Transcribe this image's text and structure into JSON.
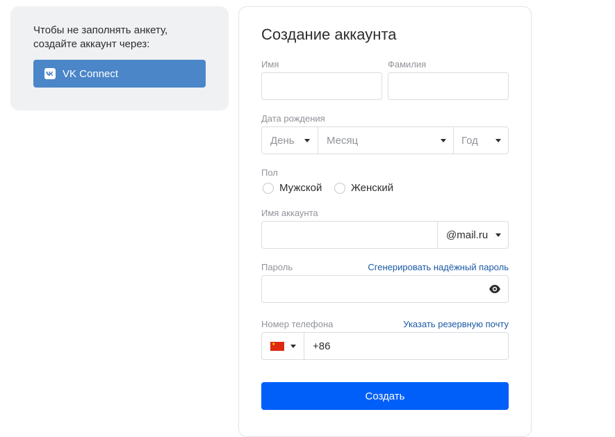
{
  "vk_panel": {
    "text": "Чтобы не заполнять анкету, создайте аккаунт через:",
    "button_label": "VK Connect",
    "button_color": "#4a86c8"
  },
  "form": {
    "title": "Создание аккаунта",
    "first_name": {
      "label": "Имя",
      "value": ""
    },
    "last_name": {
      "label": "Фамилия",
      "value": ""
    },
    "birth_date": {
      "label": "Дата рождения",
      "day_placeholder": "День",
      "month_placeholder": "Месяц",
      "year_placeholder": "Год"
    },
    "gender": {
      "label": "Пол",
      "options": [
        "Мужской",
        "Женский"
      ]
    },
    "account_name": {
      "label": "Имя аккаунта",
      "value": "",
      "domain": "@mail.ru"
    },
    "password": {
      "label": "Пароль",
      "generate_link": "Сгенерировать надёжный пароль",
      "value": ""
    },
    "phone": {
      "label": "Номер телефона",
      "backup_email_link": "Указать резервную почту",
      "country_flag": "china-flag-icon",
      "code": "+86"
    },
    "submit_label": "Создать",
    "submit_color": "#005ff9",
    "link_color": "#1a5aa5"
  }
}
